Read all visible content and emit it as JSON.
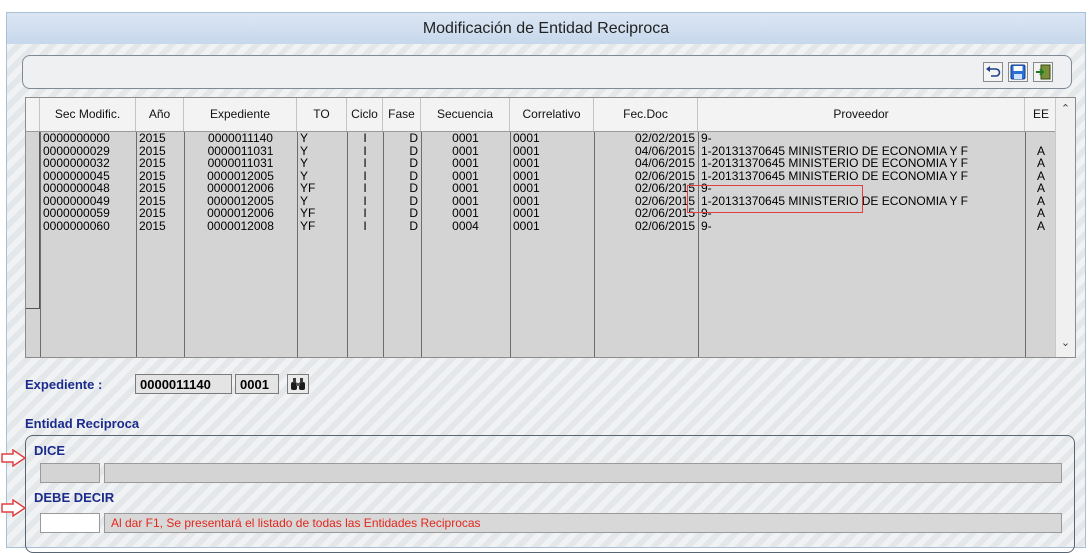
{
  "window": {
    "title": "Modificación de Entidad Reciproca"
  },
  "toolbar": {
    "icons": [
      "undo-icon",
      "save-icon",
      "exit-icon"
    ]
  },
  "grid": {
    "columns": [
      "Sec Modific.",
      "Año",
      "Expediente",
      "TO",
      "Ciclo",
      "Fase",
      "Secuencia",
      "Correlativo",
      "Fec.Doc",
      "Proveedor",
      "EE"
    ],
    "rows": [
      [
        "0000000000",
        "2015",
        "0000011140",
        "Y",
        "I",
        "D",
        "0001",
        "0001",
        "02/02/2015",
        "9-",
        ""
      ],
      [
        "0000000029",
        "2015",
        "0000011031",
        "Y",
        "I",
        "D",
        "0001",
        "0001",
        "04/06/2015",
        "1-20131370645 MINISTERIO DE ECONOMIA Y F",
        "A"
      ],
      [
        "0000000032",
        "2015",
        "0000011031",
        "Y",
        "I",
        "D",
        "0001",
        "0001",
        "04/06/2015",
        "1-20131370645 MINISTERIO DE ECONOMIA Y F",
        "A"
      ],
      [
        "0000000045",
        "2015",
        "0000012005",
        "Y",
        "I",
        "D",
        "0001",
        "0001",
        "02/06/2015",
        "1-20131370645 MINISTERIO DE ECONOMIA Y F",
        "A"
      ],
      [
        "0000000048",
        "2015",
        "0000012006",
        "YF",
        "I",
        "D",
        "0001",
        "0001",
        "02/06/2015",
        "9-",
        "A"
      ],
      [
        "0000000049",
        "2015",
        "0000012005",
        "Y",
        "I",
        "D",
        "0001",
        "0001",
        "02/06/2015",
        "1-20131370645 MINISTERIO DE ECONOMIA Y F",
        "A"
      ],
      [
        "0000000059",
        "2015",
        "0000012006",
        "YF",
        "I",
        "D",
        "0001",
        "0001",
        "02/06/2015",
        "9-",
        "A"
      ],
      [
        "0000000060",
        "2015",
        "0000012008",
        "YF",
        "I",
        "D",
        "0004",
        "0001",
        "02/06/2015",
        "9-",
        "A"
      ]
    ]
  },
  "expediente": {
    "label": "Expediente :",
    "number": "0000011140",
    "secuencia": "0001",
    "search_icon": "binoculars-icon"
  },
  "entidad": {
    "title": "Entidad Reciproca",
    "dice_label": "DICE",
    "debe_decir_label": "DEBE DECIR",
    "hint": "Al dar F1, Se presentará el listado de todas las Entidades Reciprocas"
  },
  "colors": {
    "title_blue": "#1a2b8c",
    "hint_red": "#e2271d",
    "highlight_red": "#e04040"
  }
}
